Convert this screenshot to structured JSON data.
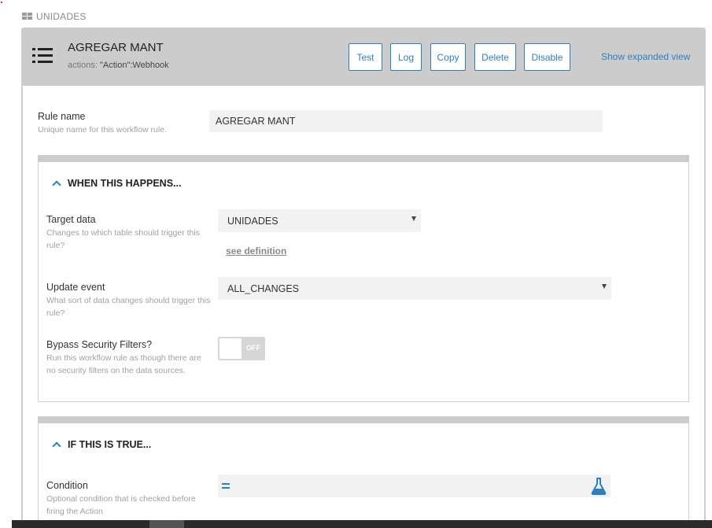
{
  "breadcrumb": {
    "label": "UNIDADES"
  },
  "header": {
    "title": "AGREGAR MANT",
    "subtitle_prefix": "actions: ",
    "subtitle_value": "\"Action\":Webhook",
    "buttons": {
      "test": "Test",
      "log": "Log",
      "copy": "Copy",
      "delete": "Delete",
      "disable": "Disable"
    },
    "expanded_link": "Show expanded view"
  },
  "rule_name": {
    "label": "Rule name",
    "help": "Unique name for this workflow rule.",
    "value": "AGREGAR MANT"
  },
  "when_section": {
    "title": "WHEN THIS HAPPENS...",
    "target_data": {
      "label": "Target data",
      "help": "Changes to which table should trigger this rule?",
      "value": "UNIDADES",
      "link": "see definition"
    },
    "update_event": {
      "label": "Update event",
      "help": "What sort of data changes should trigger this rule?",
      "value": "ALL_CHANGES"
    },
    "bypass": {
      "label": "Bypass Security Filters?",
      "help": "Run this workflow rule as though there are no security filters on the data sources.",
      "state": "OFF"
    }
  },
  "if_section": {
    "title": "IF THIS IS TRUE...",
    "condition": {
      "label": "Condition",
      "help": "Optional condition that is checked before firing the Action",
      "value": ""
    }
  },
  "colors": {
    "accent": "#2d7fc4",
    "header_bg": "#cccccc"
  }
}
